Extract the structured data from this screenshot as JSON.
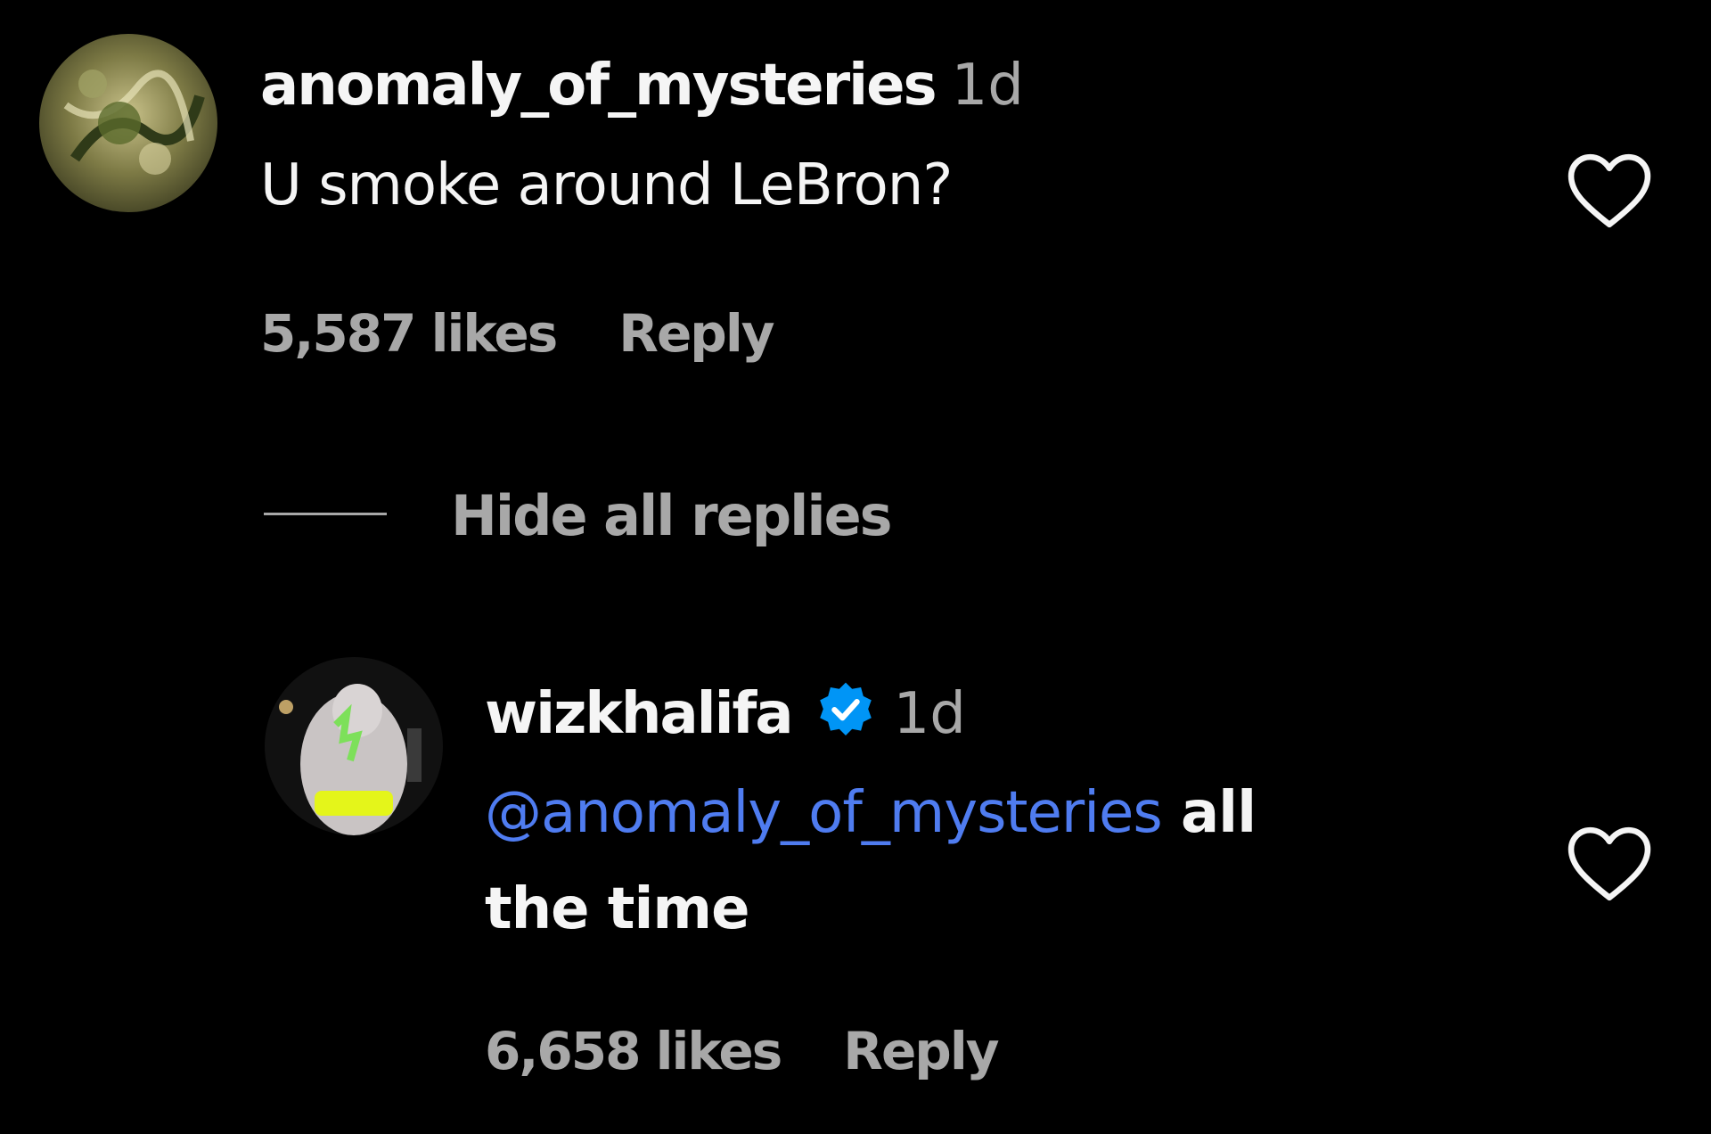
{
  "comment": {
    "username": "anomaly_of_mysteries",
    "time": "1d",
    "text": "U smoke around LeBron?",
    "likes": "5,587 likes",
    "reply_label": "Reply",
    "like_icon": "heart-outline-icon"
  },
  "replies_toggle": {
    "label": "Hide all replies"
  },
  "reply": {
    "username": "wizkhalifa",
    "verified_icon": "verified-badge-icon",
    "time": "1d",
    "mention": "@anomaly_of_mysteries",
    "text_after_mention": "all",
    "text_line2": "the time",
    "likes": "6,658 likes",
    "reply_label": "Reply",
    "like_icon": "heart-outline-icon"
  },
  "colors": {
    "background": "#000000",
    "primary_text": "#f5f5f5",
    "secondary_text": "#a8a8a8",
    "mention": "#4f7cf0",
    "verified": "#0095f6"
  }
}
